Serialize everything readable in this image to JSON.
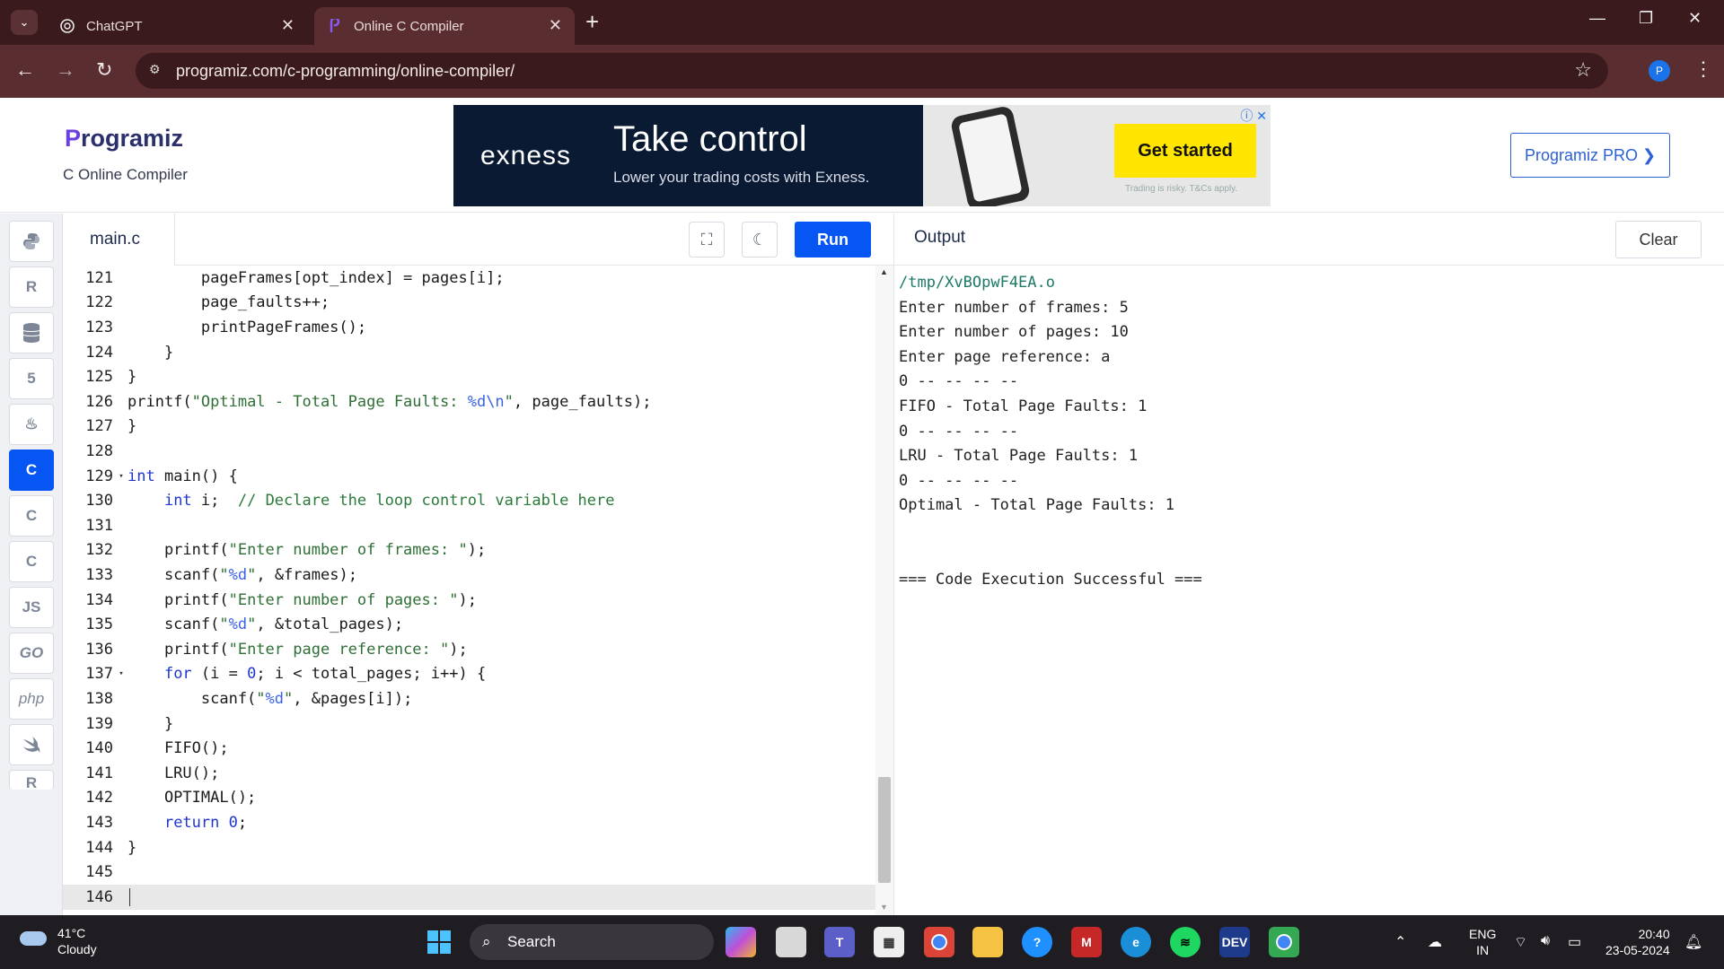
{
  "browser": {
    "tabs": [
      {
        "label": "ChatGPT",
        "icon": "openai-icon",
        "active": false
      },
      {
        "label": "Online C Compiler",
        "icon": "programiz-icon",
        "active": true
      }
    ],
    "url": "programiz.com/c-programming/online-compiler/",
    "profile_initial": "P"
  },
  "header": {
    "logo_first": "P",
    "logo_rest": "rogramiz",
    "subtitle": "C Online Compiler",
    "pro_button": "Programiz PRO ❯"
  },
  "ad": {
    "brand": "exness",
    "headline": "Take control",
    "subline": "Lower your trading costs with Exness.",
    "cta": "Get started",
    "disclaimer": "Trading is risky. T&Cs apply."
  },
  "sidebar": {
    "items": [
      {
        "name": "python",
        "label": "",
        "icon": "python-icon"
      },
      {
        "name": "r",
        "label": "R",
        "icon": "r-icon"
      },
      {
        "name": "sql",
        "label": "",
        "icon": "database-icon"
      },
      {
        "name": "html",
        "label": "5",
        "icon": "html5-icon"
      },
      {
        "name": "java",
        "label": "♨",
        "icon": "java-icon"
      },
      {
        "name": "c",
        "label": "C",
        "icon": "c-icon",
        "active": true
      },
      {
        "name": "cpp",
        "label": "C",
        "icon": "cpp-icon"
      },
      {
        "name": "csharp",
        "label": "C",
        "icon": "csharp-icon"
      },
      {
        "name": "js",
        "label": "JS",
        "icon": "javascript-icon"
      },
      {
        "name": "go",
        "label": "GO",
        "icon": "go-icon"
      },
      {
        "name": "php",
        "label": "php",
        "icon": "php-icon"
      },
      {
        "name": "swift",
        "label": "",
        "icon": "swift-icon"
      },
      {
        "name": "rust",
        "label": "R",
        "icon": "rust-icon"
      }
    ]
  },
  "editor": {
    "filename": "main.c",
    "run_label": "Run",
    "lines": [
      {
        "n": "121",
        "code": "        pageFrames[opt_index] = pages[i];"
      },
      {
        "n": "122",
        "code": "        page_faults++;"
      },
      {
        "n": "123",
        "code": "        printPageFrames();"
      },
      {
        "n": "124",
        "code": "    }"
      },
      {
        "n": "125",
        "code": "}"
      },
      {
        "n": "126",
        "code": "printf(\"Optimal - Total Page Faults: %d\\n\", page_faults);"
      },
      {
        "n": "127",
        "code": "}"
      },
      {
        "n": "128",
        "code": ""
      },
      {
        "n": "129",
        "code": "int main() {",
        "fold": true
      },
      {
        "n": "130",
        "code": "    int i;  // Declare the loop control variable here"
      },
      {
        "n": "131",
        "code": ""
      },
      {
        "n": "132",
        "code": "    printf(\"Enter number of frames: \");"
      },
      {
        "n": "133",
        "code": "    scanf(\"%d\", &frames);"
      },
      {
        "n": "134",
        "code": "    printf(\"Enter number of pages: \");"
      },
      {
        "n": "135",
        "code": "    scanf(\"%d\", &total_pages);"
      },
      {
        "n": "136",
        "code": "    printf(\"Enter page reference: \");"
      },
      {
        "n": "137",
        "code": "    for (i = 0; i < total_pages; i++) {",
        "fold": true
      },
      {
        "n": "138",
        "code": "        scanf(\"%d\", &pages[i]);"
      },
      {
        "n": "139",
        "code": "    }"
      },
      {
        "n": "140",
        "code": "    FIFO();"
      },
      {
        "n": "141",
        "code": "    LRU();"
      },
      {
        "n": "142",
        "code": "    OPTIMAL();"
      },
      {
        "n": "143",
        "code": "    return 0;"
      },
      {
        "n": "144",
        "code": "}"
      },
      {
        "n": "145",
        "code": ""
      },
      {
        "n": "146",
        "code": "",
        "current": true
      }
    ]
  },
  "output": {
    "title": "Output",
    "clear_label": "Clear",
    "lines": [
      "/tmp/XvBOpwF4EA.o",
      "Enter number of frames: 5",
      "Enter number of pages: 10",
      "Enter page reference: a",
      "0 -- -- -- --",
      "FIFO - Total Page Faults: 1",
      "0 -- -- -- --",
      "LRU - Total Page Faults: 1",
      "0 -- -- -- --",
      "Optimal - Total Page Faults: 1",
      "",
      "",
      "=== Code Execution Successful ==="
    ]
  },
  "taskbar": {
    "temperature": "41°C",
    "condition": "Cloudy",
    "search_label": "Search",
    "language_top": "ENG",
    "language_bottom": "IN",
    "time": "20:40",
    "date": "23-05-2024"
  },
  "colors": {
    "accent": "#0556f3",
    "browser_frame": "#3a1a1c",
    "ad_cta": "#ffe500"
  }
}
